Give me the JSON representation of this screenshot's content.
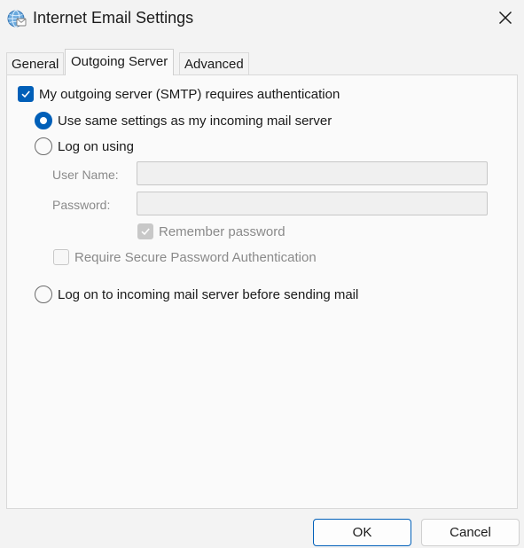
{
  "window": {
    "title": "Internet Email Settings",
    "icon": "globe-mail-icon",
    "close_icon": "close-icon"
  },
  "tabs": [
    {
      "label": "General",
      "active": false
    },
    {
      "label": "Outgoing Server",
      "active": true
    },
    {
      "label": "Advanced",
      "active": false
    }
  ],
  "outgoing": {
    "smtp_auth": {
      "label": "My outgoing server (SMTP) requires authentication",
      "checked": true
    },
    "use_same": {
      "label": "Use same settings as my incoming mail server",
      "selected": true
    },
    "log_on_using": {
      "label": "Log on using",
      "selected": false
    },
    "user_name": {
      "label": "User Name:",
      "value": ""
    },
    "password": {
      "label": "Password:",
      "value": ""
    },
    "remember_password": {
      "label": "Remember password",
      "checked": true,
      "enabled": false
    },
    "spa": {
      "label": "Require Secure Password Authentication",
      "checked": false,
      "enabled": false
    },
    "log_on_incoming": {
      "label": "Log on to incoming mail server before sending mail",
      "selected": false
    }
  },
  "buttons": {
    "ok": "OK",
    "cancel": "Cancel"
  },
  "colors": {
    "accent": "#005fb8",
    "disabled_text": "#8a8a8a",
    "background": "#f3f3f3"
  }
}
